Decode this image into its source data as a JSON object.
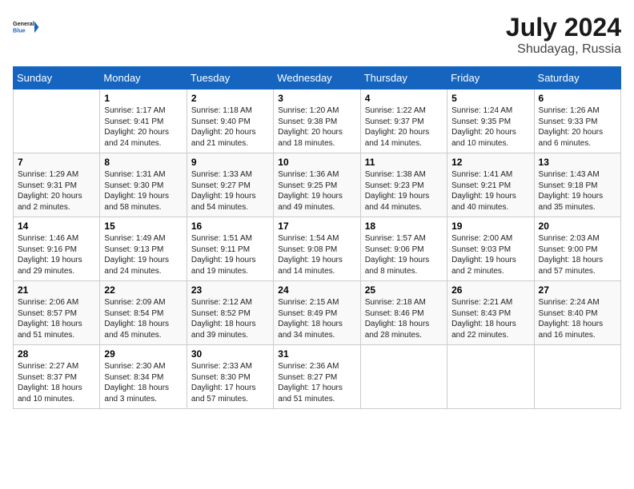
{
  "logo": {
    "line1": "General",
    "line2": "Blue"
  },
  "title": "July 2024",
  "subtitle": "Shudayag, Russia",
  "days_of_week": [
    "Sunday",
    "Monday",
    "Tuesday",
    "Wednesday",
    "Thursday",
    "Friday",
    "Saturday"
  ],
  "weeks": [
    [
      {
        "num": "",
        "info": ""
      },
      {
        "num": "1",
        "info": "Sunrise: 1:17 AM\nSunset: 9:41 PM\nDaylight: 20 hours\nand 24 minutes."
      },
      {
        "num": "2",
        "info": "Sunrise: 1:18 AM\nSunset: 9:40 PM\nDaylight: 20 hours\nand 21 minutes."
      },
      {
        "num": "3",
        "info": "Sunrise: 1:20 AM\nSunset: 9:38 PM\nDaylight: 20 hours\nand 18 minutes."
      },
      {
        "num": "4",
        "info": "Sunrise: 1:22 AM\nSunset: 9:37 PM\nDaylight: 20 hours\nand 14 minutes."
      },
      {
        "num": "5",
        "info": "Sunrise: 1:24 AM\nSunset: 9:35 PM\nDaylight: 20 hours\nand 10 minutes."
      },
      {
        "num": "6",
        "info": "Sunrise: 1:26 AM\nSunset: 9:33 PM\nDaylight: 20 hours\nand 6 minutes."
      }
    ],
    [
      {
        "num": "7",
        "info": "Sunrise: 1:29 AM\nSunset: 9:31 PM\nDaylight: 20 hours\nand 2 minutes."
      },
      {
        "num": "8",
        "info": "Sunrise: 1:31 AM\nSunset: 9:30 PM\nDaylight: 19 hours\nand 58 minutes."
      },
      {
        "num": "9",
        "info": "Sunrise: 1:33 AM\nSunset: 9:27 PM\nDaylight: 19 hours\nand 54 minutes."
      },
      {
        "num": "10",
        "info": "Sunrise: 1:36 AM\nSunset: 9:25 PM\nDaylight: 19 hours\nand 49 minutes."
      },
      {
        "num": "11",
        "info": "Sunrise: 1:38 AM\nSunset: 9:23 PM\nDaylight: 19 hours\nand 44 minutes."
      },
      {
        "num": "12",
        "info": "Sunrise: 1:41 AM\nSunset: 9:21 PM\nDaylight: 19 hours\nand 40 minutes."
      },
      {
        "num": "13",
        "info": "Sunrise: 1:43 AM\nSunset: 9:18 PM\nDaylight: 19 hours\nand 35 minutes."
      }
    ],
    [
      {
        "num": "14",
        "info": "Sunrise: 1:46 AM\nSunset: 9:16 PM\nDaylight: 19 hours\nand 29 minutes."
      },
      {
        "num": "15",
        "info": "Sunrise: 1:49 AM\nSunset: 9:13 PM\nDaylight: 19 hours\nand 24 minutes."
      },
      {
        "num": "16",
        "info": "Sunrise: 1:51 AM\nSunset: 9:11 PM\nDaylight: 19 hours\nand 19 minutes."
      },
      {
        "num": "17",
        "info": "Sunrise: 1:54 AM\nSunset: 9:08 PM\nDaylight: 19 hours\nand 14 minutes."
      },
      {
        "num": "18",
        "info": "Sunrise: 1:57 AM\nSunset: 9:06 PM\nDaylight: 19 hours\nand 8 minutes."
      },
      {
        "num": "19",
        "info": "Sunrise: 2:00 AM\nSunset: 9:03 PM\nDaylight: 19 hours\nand 2 minutes."
      },
      {
        "num": "20",
        "info": "Sunrise: 2:03 AM\nSunset: 9:00 PM\nDaylight: 18 hours\nand 57 minutes."
      }
    ],
    [
      {
        "num": "21",
        "info": "Sunrise: 2:06 AM\nSunset: 8:57 PM\nDaylight: 18 hours\nand 51 minutes."
      },
      {
        "num": "22",
        "info": "Sunrise: 2:09 AM\nSunset: 8:54 PM\nDaylight: 18 hours\nand 45 minutes."
      },
      {
        "num": "23",
        "info": "Sunrise: 2:12 AM\nSunset: 8:52 PM\nDaylight: 18 hours\nand 39 minutes."
      },
      {
        "num": "24",
        "info": "Sunrise: 2:15 AM\nSunset: 8:49 PM\nDaylight: 18 hours\nand 34 minutes."
      },
      {
        "num": "25",
        "info": "Sunrise: 2:18 AM\nSunset: 8:46 PM\nDaylight: 18 hours\nand 28 minutes."
      },
      {
        "num": "26",
        "info": "Sunrise: 2:21 AM\nSunset: 8:43 PM\nDaylight: 18 hours\nand 22 minutes."
      },
      {
        "num": "27",
        "info": "Sunrise: 2:24 AM\nSunset: 8:40 PM\nDaylight: 18 hours\nand 16 minutes."
      }
    ],
    [
      {
        "num": "28",
        "info": "Sunrise: 2:27 AM\nSunset: 8:37 PM\nDaylight: 18 hours\nand 10 minutes."
      },
      {
        "num": "29",
        "info": "Sunrise: 2:30 AM\nSunset: 8:34 PM\nDaylight: 18 hours\nand 3 minutes."
      },
      {
        "num": "30",
        "info": "Sunrise: 2:33 AM\nSunset: 8:30 PM\nDaylight: 17 hours\nand 57 minutes."
      },
      {
        "num": "31",
        "info": "Sunrise: 2:36 AM\nSunset: 8:27 PM\nDaylight: 17 hours\nand 51 minutes."
      },
      {
        "num": "",
        "info": ""
      },
      {
        "num": "",
        "info": ""
      },
      {
        "num": "",
        "info": ""
      }
    ]
  ]
}
